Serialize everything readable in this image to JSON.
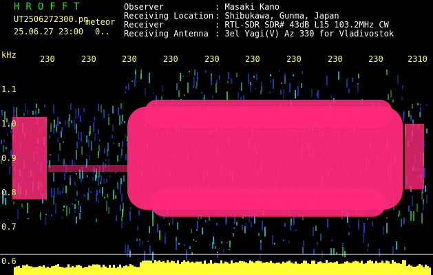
{
  "header": {
    "app_title": "HROFFT",
    "filename": "UT2506272300.pn",
    "mode": "meteor",
    "datetime": "25.06.27 23:00",
    "counter": "0..",
    "fields": [
      {
        "label": "Observer",
        "value": ": Masaki Kano"
      },
      {
        "label": "Receiving Location",
        "value": ": Shibukawa, Gunma, Japan"
      },
      {
        "label": "Receiver",
        "value": ": RTL-SDR SDR# 43dB L15 103.2MHz CW"
      },
      {
        "label": "Receiving Antenna",
        "value": ": 3el Yagi(V) Az 330 for Vladivostok"
      }
    ]
  },
  "axis": {
    "unit": "kHz",
    "y_ticks": [
      "1.1",
      "1.0",
      "0.9",
      "0.8",
      "0.7",
      "0.6"
    ],
    "time_ticks": [
      "230",
      "230",
      "230",
      "230",
      "230",
      "230",
      "230",
      "230",
      "230",
      "2310"
    ]
  },
  "colors": {
    "background": "#000000",
    "header_text": "#ffffff",
    "title_green": "#22dd22",
    "axis_text": "#ffff66",
    "echo_magenta": "#ff2a7a",
    "noise_blue": "#1a44cc",
    "noise_cyan": "#22bbcc",
    "noise_green": "#33cc44",
    "level_yellow": "#ffff33"
  }
}
